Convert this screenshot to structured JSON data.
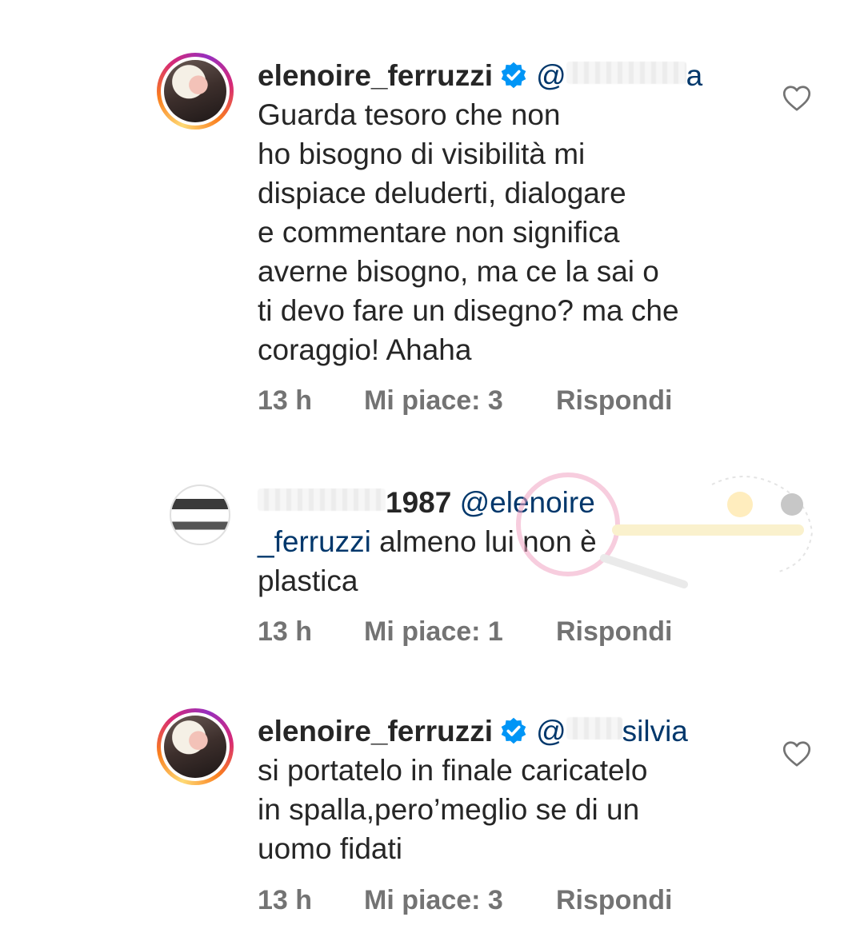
{
  "comments": [
    {
      "username": "elenoire_ferruzzi",
      "verified": true,
      "mention_visible": "@",
      "mention_tail": "a",
      "lines": [
        "Guarda tesoro che non",
        "ho bisogno di visibilità mi",
        "dispiace deluderti, dialogare",
        "e commentare non significa",
        "averne bisogno, ma ce la sai o",
        "ti devo fare un disegno? ma che",
        "coraggio! Ahaha"
      ],
      "time": "13 h",
      "likes": "Mi piace: 3",
      "reply": "Rispondi",
      "like_icon": "heart-outline-icon"
    },
    {
      "username": "1987",
      "mention": "@elenoire",
      "lines": [
        "_ferruzzi",
        "almeno lui non è",
        "plastica"
      ],
      "time": "13 h",
      "likes": "Mi piace: 1",
      "reply": "Rispondi"
    },
    {
      "username": "elenoire_ferruzzi",
      "verified": true,
      "mention_visible": "@",
      "mention_tail": "silvia",
      "lines": [
        "si portatelo in finale caricatelo",
        "in spalla,pero’meglio se di un",
        "uomo fidati"
      ],
      "time": "13 h",
      "likes": "Mi piace: 3",
      "reply": "Rispondi",
      "like_icon": "heart-outline-icon"
    }
  ],
  "colors": {
    "text": "#262626",
    "meta": "#737373",
    "mention": "#00376b",
    "verified": "#0095f6"
  }
}
